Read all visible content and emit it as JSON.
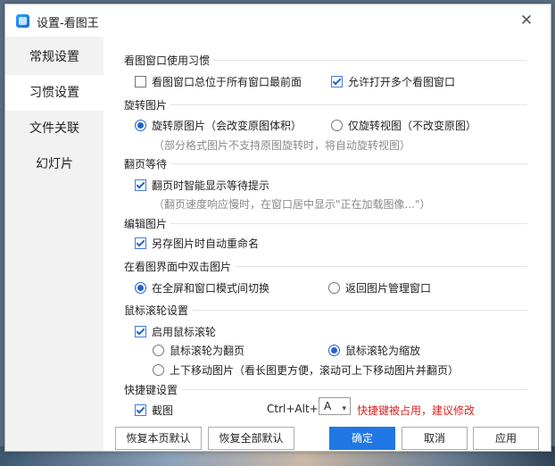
{
  "window": {
    "title": "设置-看图王",
    "close_glyph": "✕"
  },
  "sidebar": {
    "items": [
      {
        "label": "常规设置",
        "active": false
      },
      {
        "label": "习惯设置",
        "active": true
      },
      {
        "label": "文件关联",
        "active": false
      },
      {
        "label": "幻灯片",
        "active": false
      }
    ]
  },
  "sections": {
    "viewer_window": {
      "title": "看图窗口使用习惯",
      "always_on_top": {
        "label": "看图窗口总位于所有窗口最前面",
        "checked": false
      },
      "allow_multiple": {
        "label": "允许打开多个看图窗口",
        "checked": true
      }
    },
    "rotate": {
      "title": "旋转图片",
      "rotate_original": {
        "label": "旋转原图片（会改变原图体积）",
        "selected": true
      },
      "rotate_view": {
        "label": "仅旋转视图（不改变原图）",
        "selected": false
      },
      "hint": "（部分格式图片不支持原图旋转时，将自动旋转视图）"
    },
    "paging_wait": {
      "title": "翻页等待",
      "smart_wait": {
        "label": "翻页时智能显示等待提示",
        "checked": true
      },
      "hint": "（翻页速度响应慢时，在窗口居中显示\"正在加载图像...\"）"
    },
    "edit": {
      "title": "编辑图片",
      "auto_rename": {
        "label": "另存图片时自动重命名",
        "checked": true
      }
    },
    "double_click": {
      "title": "在看图界面中双击图片",
      "toggle_fullscreen": {
        "label": "在全屏和窗口模式间切换",
        "selected": true
      },
      "back_to_manager": {
        "label": "返回图片管理窗口",
        "selected": false
      }
    },
    "mouse_wheel": {
      "title": "鼠标滚轮设置",
      "enable_wheel": {
        "label": "启用鼠标滚轮",
        "checked": true
      },
      "wheel_page": {
        "label": "鼠标滚轮为翻页",
        "selected": false
      },
      "wheel_zoom": {
        "label": "鼠标滚轮为缩放",
        "selected": true
      },
      "wheel_move": {
        "label": "上下移动图片（看长图更方便，滚动可上下移动图片并翻页）",
        "selected": false
      }
    },
    "hotkey": {
      "title": "快捷键设置",
      "screenshot": {
        "label": "截图",
        "checked": true
      },
      "combo_label": "Ctrl+Alt+",
      "key_value": "A",
      "warning": "快捷键被占用，建议修改"
    }
  },
  "buttons": {
    "restore_page": "恢复本页默认",
    "restore_all": "恢复全部默认",
    "ok": "确定",
    "cancel": "取消",
    "apply": "应用"
  },
  "colors": {
    "accent": "#1f78e5",
    "warning": "#e0211e",
    "hint": "#8a8a8a"
  }
}
